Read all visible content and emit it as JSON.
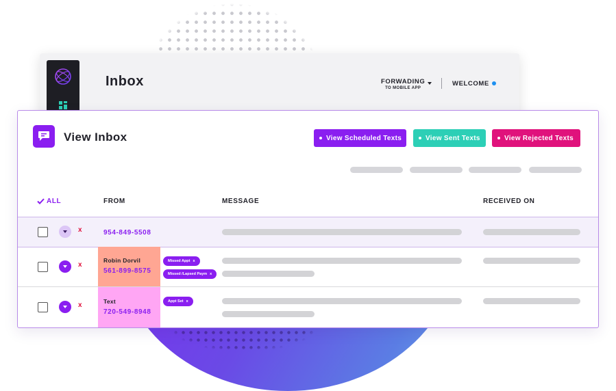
{
  "colors": {
    "accent_purple": "#8a1ef0",
    "teal": "#2ccfb6",
    "magenta": "#e0127c",
    "from_salmon": "#ffa693",
    "from_pink": "#ffa6f4",
    "remove_red": "#e0103a",
    "status_blue": "#1e90f0"
  },
  "back_window": {
    "sidebar_icons": [
      "globe-logo-icon",
      "grid-icon"
    ],
    "title": "Inbox",
    "forwarding": {
      "label": "FORWADING",
      "sublabel": "TO MOBILE APP",
      "icon": "chevron-down-icon"
    },
    "welcome": "WELCOME",
    "status_icon": "status-dot"
  },
  "panel": {
    "icon": "message-bubble-icon",
    "title": "View Inbox",
    "buttons": {
      "scheduled": "View Scheduled Texts",
      "sent": "View Sent Texts",
      "rejected": "View Rejected Texts"
    }
  },
  "table": {
    "headers": {
      "all": "ALL",
      "from": "FROM",
      "message": "MESSAGE",
      "received": "RECEIVED ON"
    },
    "rows": [
      {
        "name": "",
        "phone": "954-849-5508",
        "tags": [],
        "remove": "x"
      },
      {
        "name": "Robin Dorvil",
        "phone": "561-899-8575",
        "tags": [
          "Missed Appt",
          "Missed /Lapsed Paym"
        ],
        "remove": "x"
      },
      {
        "name": "Text",
        "phone": "720-549-8948",
        "tags": [
          "Appt Set"
        ],
        "remove": "x"
      }
    ],
    "tag_remove": "x"
  }
}
